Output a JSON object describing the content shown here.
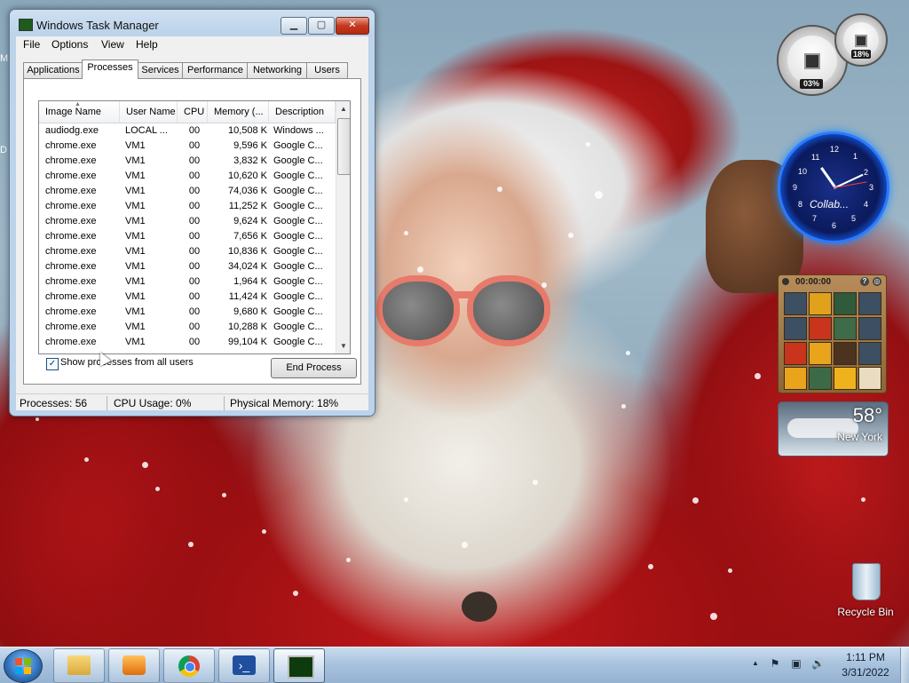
{
  "window": {
    "title": "Windows Task Manager",
    "minimize_glyph": "▁",
    "maximize_glyph": "▢",
    "close_glyph": "✕",
    "menu": [
      "File",
      "Options",
      "View",
      "Help"
    ],
    "tabs": [
      "Applications",
      "Processes",
      "Services",
      "Performance",
      "Networking",
      "Users"
    ],
    "active_tab": "Processes"
  },
  "processes": {
    "columns": [
      "Image Name",
      "User Name",
      "CPU",
      "Memory (...",
      "Description"
    ],
    "sort_column": "Image Name",
    "rows": [
      {
        "image": "audiodg.exe",
        "user": "LOCAL ...",
        "cpu": "00",
        "memory": "10,508 K",
        "desc": "Windows ..."
      },
      {
        "image": "chrome.exe",
        "user": "VM1",
        "cpu": "00",
        "memory": "9,596 K",
        "desc": "Google C..."
      },
      {
        "image": "chrome.exe",
        "user": "VM1",
        "cpu": "00",
        "memory": "3,832 K",
        "desc": "Google C..."
      },
      {
        "image": "chrome.exe",
        "user": "VM1",
        "cpu": "00",
        "memory": "10,620 K",
        "desc": "Google C..."
      },
      {
        "image": "chrome.exe",
        "user": "VM1",
        "cpu": "00",
        "memory": "74,036 K",
        "desc": "Google C..."
      },
      {
        "image": "chrome.exe",
        "user": "VM1",
        "cpu": "00",
        "memory": "11,252 K",
        "desc": "Google C..."
      },
      {
        "image": "chrome.exe",
        "user": "VM1",
        "cpu": "00",
        "memory": "9,624 K",
        "desc": "Google C..."
      },
      {
        "image": "chrome.exe",
        "user": "VM1",
        "cpu": "00",
        "memory": "7,656 K",
        "desc": "Google C..."
      },
      {
        "image": "chrome.exe",
        "user": "VM1",
        "cpu": "00",
        "memory": "10,836 K",
        "desc": "Google C..."
      },
      {
        "image": "chrome.exe",
        "user": "VM1",
        "cpu": "00",
        "memory": "34,024 K",
        "desc": "Google C..."
      },
      {
        "image": "chrome.exe",
        "user": "VM1",
        "cpu": "00",
        "memory": "1,964 K",
        "desc": "Google C..."
      },
      {
        "image": "chrome.exe",
        "user": "VM1",
        "cpu": "00",
        "memory": "11,424 K",
        "desc": "Google C..."
      },
      {
        "image": "chrome.exe",
        "user": "VM1",
        "cpu": "00",
        "memory": "9,680 K",
        "desc": "Google C..."
      },
      {
        "image": "chrome.exe",
        "user": "VM1",
        "cpu": "00",
        "memory": "10,288 K",
        "desc": "Google C..."
      },
      {
        "image": "chrome.exe",
        "user": "VM1",
        "cpu": "00",
        "memory": "99,104 K",
        "desc": "Google C..."
      }
    ],
    "show_all_users_label": "Show processes from all users",
    "show_all_users_checked": true,
    "check_glyph": "✓",
    "end_process_label": "End Process",
    "scroll_up_glyph": "▲",
    "scroll_down_glyph": "▼"
  },
  "status": {
    "processes": "Processes: 56",
    "cpu": "CPU Usage: 0%",
    "memory": "Physical Memory: 18%"
  },
  "gadgets": {
    "cpu_meter": {
      "cpu_percent": "03%",
      "memory_percent": "18%"
    },
    "clock": {
      "brand": "Collab..."
    },
    "puzzle": {
      "timer": "00:00:00",
      "help": "?",
      "toggle": "◎"
    },
    "weather": {
      "temperature": "58°",
      "city": "New York"
    }
  },
  "desktop": {
    "recycle_bin_label": "Recycle Bin",
    "edge_letters": [
      "M",
      "D"
    ]
  },
  "taskbar": {
    "tray_arrow": "▲",
    "tray_icons": [
      "flag-icon",
      "network-icon",
      "volume-icon"
    ],
    "tray_glyphs": [
      "⚑",
      "▣",
      "🔊"
    ],
    "time": "1:11 PM",
    "date": "3/31/2022"
  },
  "colors": {
    "window_frame": "#bcd3ea",
    "close_button": "#c4381f",
    "clock_ring": "#2a7bff",
    "taskbar": "#a9c3de"
  }
}
